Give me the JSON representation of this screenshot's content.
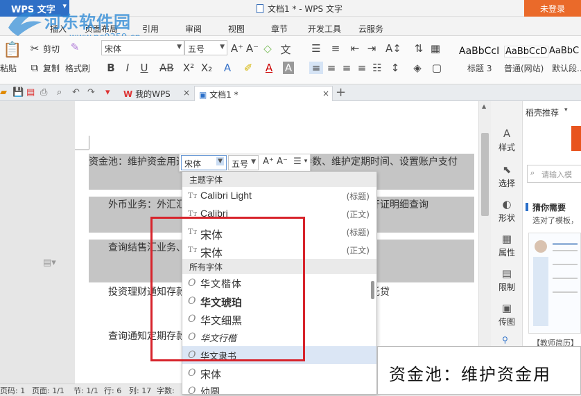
{
  "titlebar": {
    "app_menu": "WPS 文字",
    "doc_title": "文档1 * - WPS 文字",
    "login": "未登录"
  },
  "watermark": {
    "text": "河东软件园",
    "url": "www.pc0359.cn"
  },
  "menu_tabs": [
    "插入",
    "页面布局",
    "引用",
    "审阅",
    "视图",
    "章节",
    "开发工具",
    "云服务"
  ],
  "ribbon": {
    "paste": "粘贴",
    "cut": "剪切",
    "copy": "复制",
    "format_painter": "格式刷",
    "font_name": "宋体",
    "font_size": "五号",
    "styles": [
      {
        "sample": "AaBbCcI",
        "label": "标题 3"
      },
      {
        "sample": "AaBbCcD",
        "label": "普通(网站)"
      },
      {
        "sample": "AaBbC",
        "label": "默认段..."
      }
    ]
  },
  "doc_tabs": [
    {
      "label": "我的WPS"
    },
    {
      "label": "文档1 *"
    }
  ],
  "document": {
    "paragraphs": [
      "资金池：维护资金用途、维护贸易伙伴、维护归集参数、维护定期时间、设置账户支付",
      "外币业务：外汇汇款、申请证到单以及付汇查询、进口信用证开证明细查询",
      "查询结售汇业务、光票托收、购汇、汇出汇款查询、汇出汇款",
      "投资理财通知存款、托贷款合约查询、委托贷款利息试算、委托贷",
      "查询通知定期存款转通知存款、利息试算、取消通知"
    ]
  },
  "mini_toolbar": {
    "font": "宋体",
    "size": "五号"
  },
  "font_dropdown": {
    "theme_header": "主题字体",
    "all_header": "所有字体",
    "theme_fonts": [
      {
        "name": "Calibri Light",
        "tag": "(标题)"
      },
      {
        "name": "Calibri",
        "tag": "(正文)"
      },
      {
        "name": "宋体",
        "tag": "(标题)"
      },
      {
        "name": "宋体",
        "tag": "(正文)"
      }
    ],
    "all_fonts": [
      {
        "name": "华文楷体"
      },
      {
        "name": "华文琥珀"
      },
      {
        "name": "华文细黑"
      },
      {
        "name": "华文行楷"
      },
      {
        "name": "华文隶书"
      },
      {
        "name": "宋体"
      },
      {
        "name": "幼圆"
      }
    ]
  },
  "sidebar": {
    "items": [
      "样式",
      "选择",
      "形状",
      "属性",
      "限制",
      "传图"
    ],
    "panel_title": "稻壳推荐",
    "search_placeholder": "请输入模",
    "guess_title": "猜你需要",
    "guess_sub": "选对了模板，",
    "template_caption": "【教师简历】"
  },
  "statusbar": {
    "page_code": "页码: 1",
    "pages": "页面: 1/1",
    "section": "节: 1/1",
    "row": "行: 6",
    "col": "列: 17",
    "words": "字数:"
  },
  "preview_text": "资金池：维护资金用"
}
